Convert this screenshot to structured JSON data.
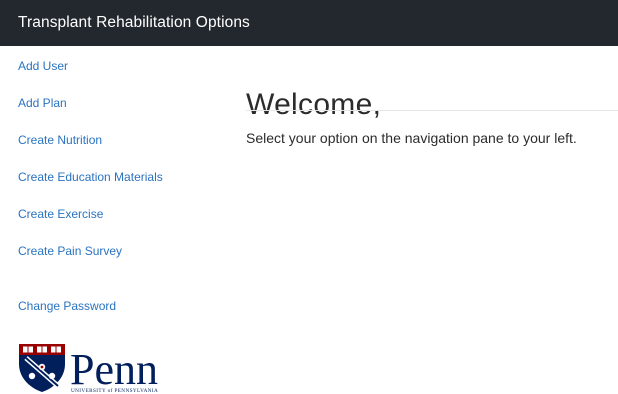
{
  "header": {
    "title": "Transplant Rehabilitation Options"
  },
  "sidebar": {
    "items": [
      {
        "label": "Add User"
      },
      {
        "label": "Add Plan"
      },
      {
        "label": "Create Nutrition"
      },
      {
        "label": "Create Education Materials"
      },
      {
        "label": "Create Exercise"
      },
      {
        "label": "Create Pain Survey"
      },
      {
        "label": "Change Password"
      }
    ]
  },
  "main": {
    "heading": "Welcome,",
    "message": "Select your option on the navigation pane to your left."
  },
  "logo": {
    "wordmark": "Penn",
    "subtitle": "UNIVERSITY of PENNSYLVANIA"
  },
  "colors": {
    "header_bg": "#23282e",
    "link": "#2a73c0",
    "penn_blue": "#011f5b",
    "penn_red": "#990000"
  }
}
